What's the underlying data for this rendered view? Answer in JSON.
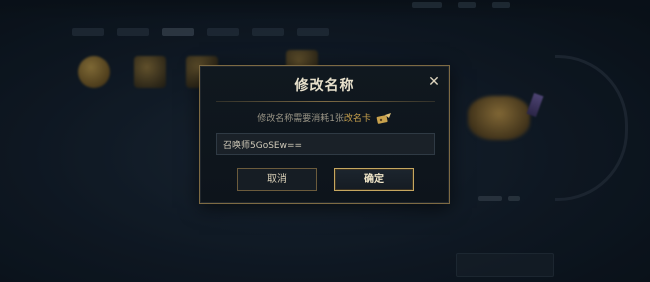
{
  "dialog": {
    "title": "修改名称",
    "close_symbol": "✕",
    "cost_prefix": "修改名称需要消耗1张",
    "cost_item": "改名卡",
    "ticket_icon": "name-change-card-icon",
    "input_value": "召唤师5GoSEw==",
    "cancel_label": "取消",
    "confirm_label": "确定"
  },
  "colors": {
    "accent_gold": "#c9a24d",
    "border_gold": "#7d6a43",
    "background": "#121c29"
  }
}
